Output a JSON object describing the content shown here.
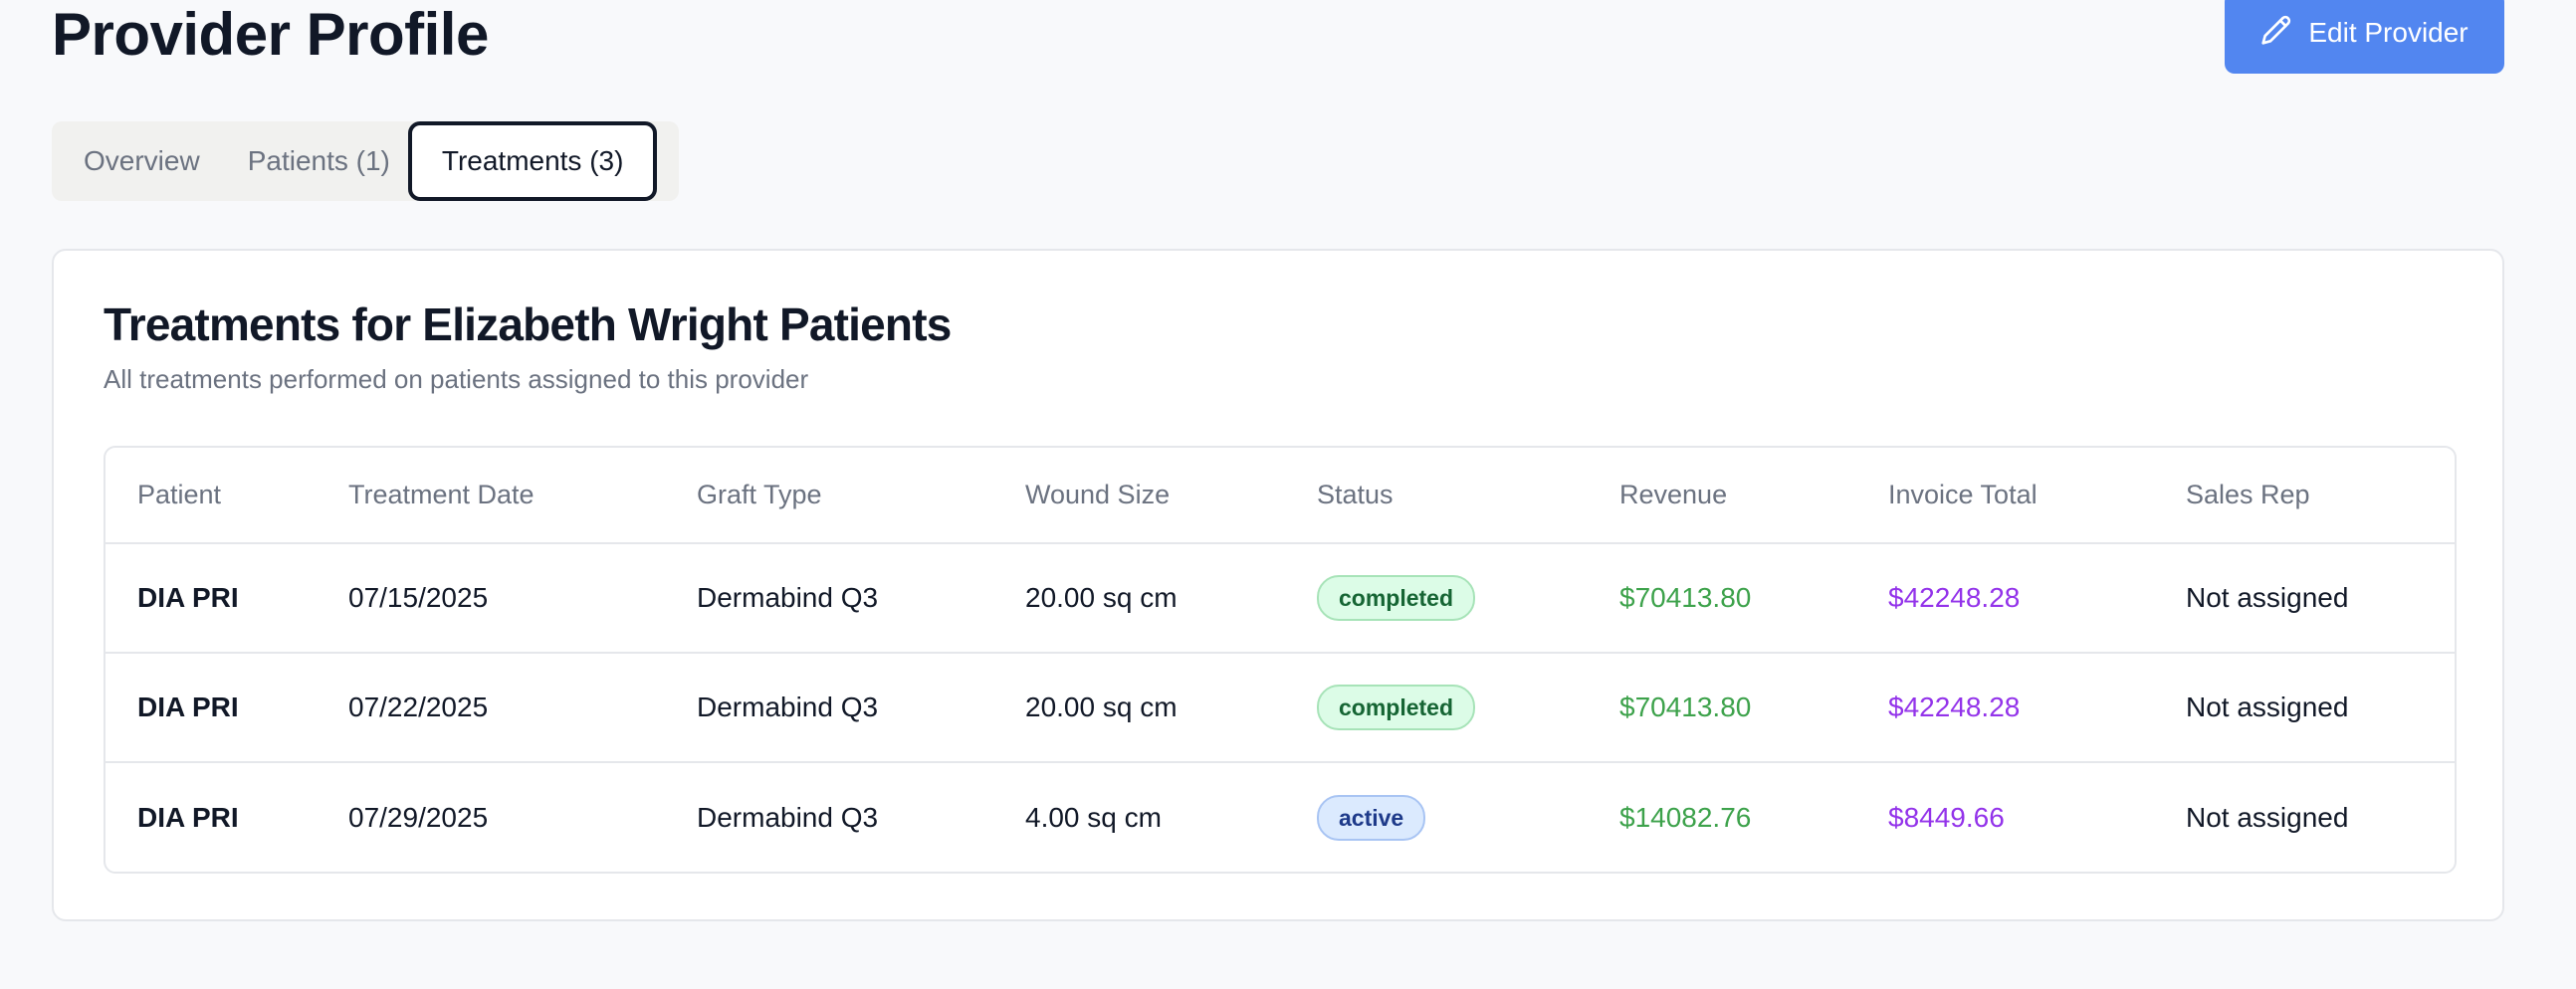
{
  "header": {
    "title": "Provider Profile",
    "edit_button_label": "Edit Provider",
    "edit_icon": "pencil-icon"
  },
  "tabs": [
    {
      "label": "Overview",
      "active": false
    },
    {
      "label": "Patients (1)",
      "active": false
    },
    {
      "label": "Treatments (3)",
      "active": true
    }
  ],
  "card": {
    "title": "Treatments for Elizabeth Wright Patients",
    "subtitle": "All treatments performed on patients assigned to this provider"
  },
  "table": {
    "columns": [
      "Patient",
      "Treatment Date",
      "Graft Type",
      "Wound Size",
      "Status",
      "Revenue",
      "Invoice Total",
      "Sales Rep"
    ],
    "rows": [
      {
        "patient": "DIA PRI",
        "date": "07/15/2025",
        "graft": "Dermabind Q3",
        "wound": "20.00 sq cm",
        "status": "completed",
        "revenue": "$70413.80",
        "invoice": "$42248.28",
        "rep": "Not assigned"
      },
      {
        "patient": "DIA PRI",
        "date": "07/22/2025",
        "graft": "Dermabind Q3",
        "wound": "20.00 sq cm",
        "status": "completed",
        "revenue": "$70413.80",
        "invoice": "$42248.28",
        "rep": "Not assigned"
      },
      {
        "patient": "DIA PRI",
        "date": "07/29/2025",
        "graft": "Dermabind Q3",
        "wound": "4.00 sq cm",
        "status": "active",
        "revenue": "$14082.76",
        "invoice": "$8449.66",
        "rep": "Not assigned"
      }
    ]
  },
  "colors": {
    "primary_button": "#5286f0",
    "revenue": "#3da24b",
    "invoice": "#9333ea",
    "completed_badge": "#dcfce7",
    "active_badge": "#dbeafe"
  }
}
